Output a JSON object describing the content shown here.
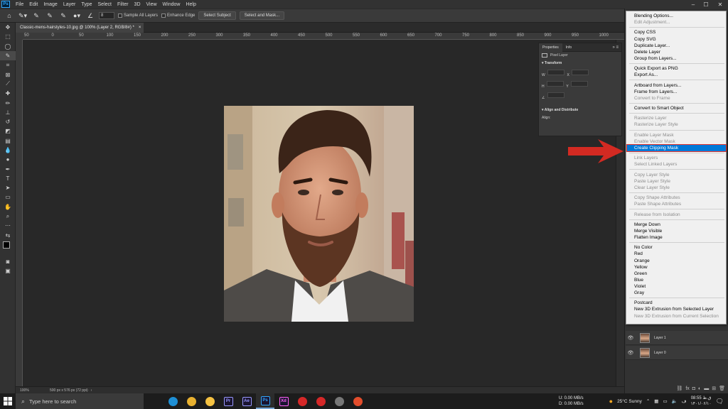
{
  "app": {
    "logo": "Ps",
    "menus": [
      "File",
      "Edit",
      "Image",
      "Layer",
      "Type",
      "Select",
      "Filter",
      "3D",
      "View",
      "Window",
      "Help"
    ],
    "window_controls": [
      "–",
      "☐",
      "✕"
    ]
  },
  "options_bar": {
    "brush_size": "8",
    "sample_all_layers": "Sample All Layers",
    "enhance_edge": "Enhance Edge",
    "select_subject": "Select Subject",
    "select_and_mask": "Select and Mask..."
  },
  "document": {
    "tab_title": "Classic-mens-hairstyles-10.jpg @ 100% (Layer 2, RGB/8#) *",
    "ruler_ticks": [
      "50",
      "0",
      "50",
      "100",
      "150",
      "200",
      "250",
      "300",
      "350",
      "400",
      "450",
      "500",
      "550",
      "600",
      "650",
      "700",
      "750",
      "800",
      "850",
      "900",
      "950",
      "1000"
    ],
    "status_zoom": "100%",
    "status_info": "500 px x 576 px (72 ppi)"
  },
  "properties_panel": {
    "tabs": [
      "Properties",
      "Info"
    ],
    "layer_type": "Pixel Layer",
    "transform_label": "Transform",
    "align_label": "Align and Distribute",
    "align_sub": "Align:",
    "field_labels": [
      "W",
      "X",
      "H",
      "Y"
    ]
  },
  "context_menu": {
    "items": [
      {
        "label": "Blending Options...",
        "enabled": true
      },
      {
        "label": "Edit Adjustment...",
        "enabled": false
      },
      {
        "label": "Copy CSS",
        "enabled": true
      },
      {
        "label": "Copy SVG",
        "enabled": true
      },
      {
        "label": "Duplicate Layer...",
        "enabled": true
      },
      {
        "label": "Delete Layer",
        "enabled": true
      },
      {
        "label": "Group from Layers...",
        "enabled": true
      },
      {
        "label": "Quick Export as PNG",
        "enabled": true
      },
      {
        "label": "Export As...",
        "enabled": true
      },
      {
        "label": "Artboard from Layers...",
        "enabled": true
      },
      {
        "label": "Frame from Layers...",
        "enabled": true
      },
      {
        "label": "Convert to Frame",
        "enabled": false
      },
      {
        "label": "Convert to Smart Object",
        "enabled": true
      },
      {
        "label": "Rasterize Layer",
        "enabled": false
      },
      {
        "label": "Rasterize Layer Style",
        "enabled": false
      },
      {
        "label": "Enable Layer Mask",
        "enabled": false
      },
      {
        "label": "Enable Vector Mask",
        "enabled": false
      },
      {
        "label": "Create Clipping Mask",
        "enabled": true,
        "highlighted": true
      },
      {
        "label": "Link Layers",
        "enabled": false
      },
      {
        "label": "Select Linked Layers",
        "enabled": false
      },
      {
        "label": "Copy Layer Style",
        "enabled": false
      },
      {
        "label": "Paste Layer Style",
        "enabled": false
      },
      {
        "label": "Clear Layer Style",
        "enabled": false
      },
      {
        "label": "Copy Shape Attributes",
        "enabled": false
      },
      {
        "label": "Paste Shape Attributes",
        "enabled": false
      },
      {
        "label": "Release from Isolation",
        "enabled": false
      },
      {
        "label": "Merge Down",
        "enabled": true
      },
      {
        "label": "Merge Visible",
        "enabled": true
      },
      {
        "label": "Flatten Image",
        "enabled": true
      },
      {
        "label": "No Color",
        "enabled": true
      },
      {
        "label": "Red",
        "enabled": true
      },
      {
        "label": "Orange",
        "enabled": true
      },
      {
        "label": "Yellow",
        "enabled": true
      },
      {
        "label": "Green",
        "enabled": true
      },
      {
        "label": "Blue",
        "enabled": true
      },
      {
        "label": "Violet",
        "enabled": true
      },
      {
        "label": "Gray",
        "enabled": true
      },
      {
        "label": "Postcard",
        "enabled": true
      },
      {
        "label": "New 3D Extrusion from Selected Layer",
        "enabled": true
      },
      {
        "label": "New 3D Extrusion from Current Selection",
        "enabled": false
      }
    ]
  },
  "layers": [
    {
      "name": "Layer 1"
    },
    {
      "name": "Layer 0"
    }
  ],
  "taskbar": {
    "search_placeholder": "Type here to search",
    "apps": [
      {
        "name": "edge",
        "label": "",
        "color": "#1e8fd5"
      },
      {
        "name": "chrome",
        "label": "",
        "color": "#e8b130"
      },
      {
        "name": "explorer",
        "label": "",
        "color": "#f5c242"
      },
      {
        "name": "premiere",
        "label": "Pr",
        "color": "#9999ff"
      },
      {
        "name": "after-effects",
        "label": "Ae",
        "color": "#9999ff"
      },
      {
        "name": "photoshop",
        "label": "Ps",
        "color": "#31a8ff"
      },
      {
        "name": "xd",
        "label": "Xd",
        "color": "#ff61f6"
      },
      {
        "name": "shield",
        "label": "",
        "color": "#d62828"
      },
      {
        "name": "record",
        "label": "",
        "color": "#d62828"
      },
      {
        "name": "calculator",
        "label": "",
        "color": "#777777"
      },
      {
        "name": "red-app",
        "label": "",
        "color": "#e34d2c"
      }
    ],
    "net_up_label": "U:",
    "net_down_label": "D:",
    "net_up": "0.00 MB/s",
    "net_down": "0.00 MB/s",
    "weather": "25°C  Sunny",
    "time": "08:55 ق.ظ",
    "date": "۱۴۰۱/۰۶/۱۰"
  },
  "colors": {
    "accent_highlight": "#0078d7",
    "arrow": "#d32a22"
  }
}
